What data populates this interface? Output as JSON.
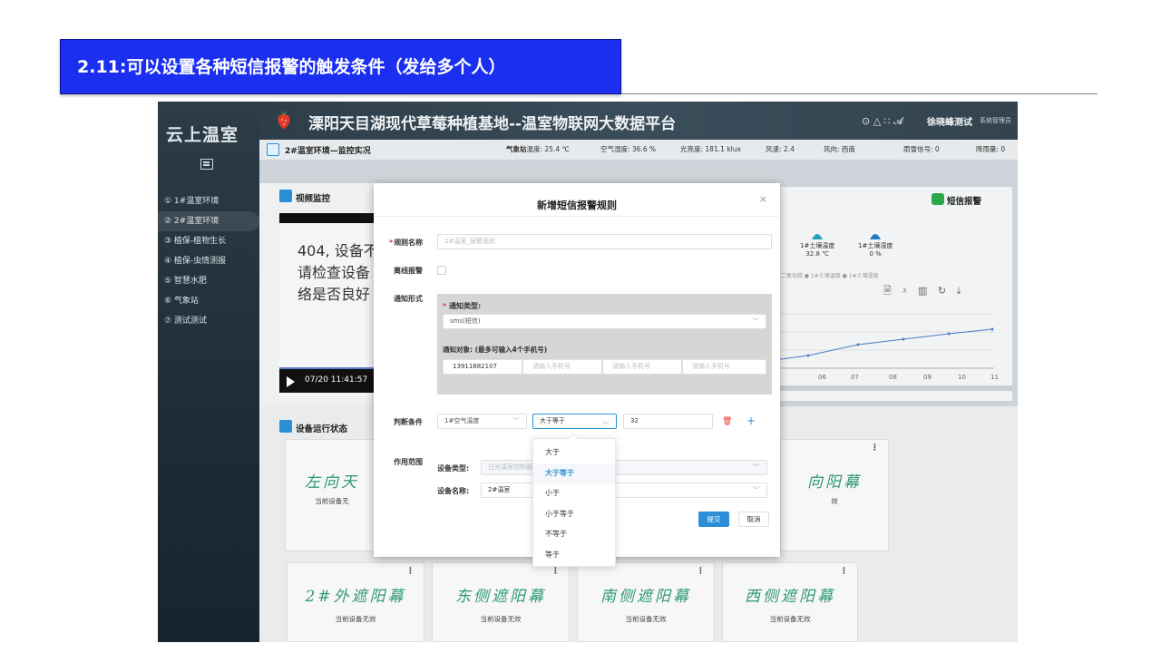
{
  "slide": {
    "title": "2.11:可以设置各种短信报警的触发条件（发给多个人）"
  },
  "sidebar": {
    "brand": "云上温室",
    "items": [
      {
        "label": "① 1#温室环境"
      },
      {
        "label": "② 2#温室环境"
      },
      {
        "label": "③ 植保-植物生长"
      },
      {
        "label": "④ 植保-虫情测报"
      },
      {
        "label": "⑤ 智慧水肥"
      },
      {
        "label": "⑥ 气象站"
      },
      {
        "label": "⑦ 测试测试"
      }
    ]
  },
  "topbar": {
    "system_title": "溧阳天目湖现代草莓种植基地--温室物联网大数据平台",
    "tools": "⊙ △ ∷ 𝓐",
    "user": "徐晓峰测试",
    "role": "系统管理员"
  },
  "breadcrumb": {
    "title": "2#温室环境—监控实况",
    "station_label": "气象站",
    "temp": "温度: 25.4 ℃",
    "humidity": "空气湿度: 36.6 %",
    "light": "光亮度: 181.1 klux",
    "wind_speed": "风速: 2.4",
    "wind_dir": "风向: 西南",
    "rain_snow": "雨雪信号: 0",
    "rainfall": "降雨量: 0"
  },
  "video": {
    "title": "视频监控",
    "error_lines": [
      "404, 设备不",
      "请检查设备",
      "络是否良好"
    ],
    "time": "07/20 11:41:57"
  },
  "chart_panel": {
    "sms_alarm": "短信报警",
    "soil_temp": {
      "label": "1#土壤温度",
      "value": "32.8 ℃"
    },
    "soil_hum": {
      "label": "1#土壤湿度",
      "value": "0 %"
    },
    "legend": "1#二氧化碳 ● 1#土壤温度 ● 1#土壤湿度",
    "x_ticks": [
      "06",
      "07",
      "08",
      "09",
      "10",
      "11"
    ],
    "icons": "🗎 ⩡ ▥ ↻ ⤓"
  },
  "run_status": {
    "title": "设备运行状态",
    "cards": [
      {
        "name": "左向天",
        "status": "当前设备无"
      },
      {
        "name": "向阳幕",
        "status": "效"
      },
      {
        "name": "2#外遮阳幕",
        "status": "当前设备无效"
      },
      {
        "name": "东侧遮阳幕",
        "status": "当前设备无效"
      },
      {
        "name": "南侧遮阳幕",
        "status": "当前设备无效"
      },
      {
        "name": "西侧遮阳幕",
        "status": "当前设备无效"
      }
    ]
  },
  "modal": {
    "title": "新增短信报警规则",
    "close": "×",
    "rule_name_label": "规则名称",
    "rule_name_placeholder": "2#温室_报警规则",
    "offline_label": "离线报警",
    "notify_label": "通知形式",
    "notify_type_label": "通知类型:",
    "notify_type_value": "sms(短信)",
    "targets_label": "通知对象: (最多可输入4个手机号)",
    "phones": [
      "13911682107",
      "请输入手机号",
      "请输入手机号",
      "请输入手机号"
    ],
    "condition_label": "判断条件",
    "condition_field": "1#空气温度",
    "condition_operator": "大于等于",
    "condition_value": "32",
    "scope_label": "作用范围",
    "device_type_label": "设备类型:",
    "device_type_value": "日光温室控制器",
    "device_name_label": "设备名称:",
    "device_name_value": "2#温室",
    "submit": "提交",
    "cancel": "取消"
  },
  "operator_dropdown": {
    "options": [
      "大于",
      "大于等于",
      "小于",
      "小于等于",
      "不等于",
      "等于"
    ],
    "selected": "大于等于"
  },
  "colors": {
    "slide_title_bg": "#1a2ff0",
    "accent": "#2a8fd8",
    "teal_text": "#2f9a73",
    "danger": "#e33333"
  }
}
